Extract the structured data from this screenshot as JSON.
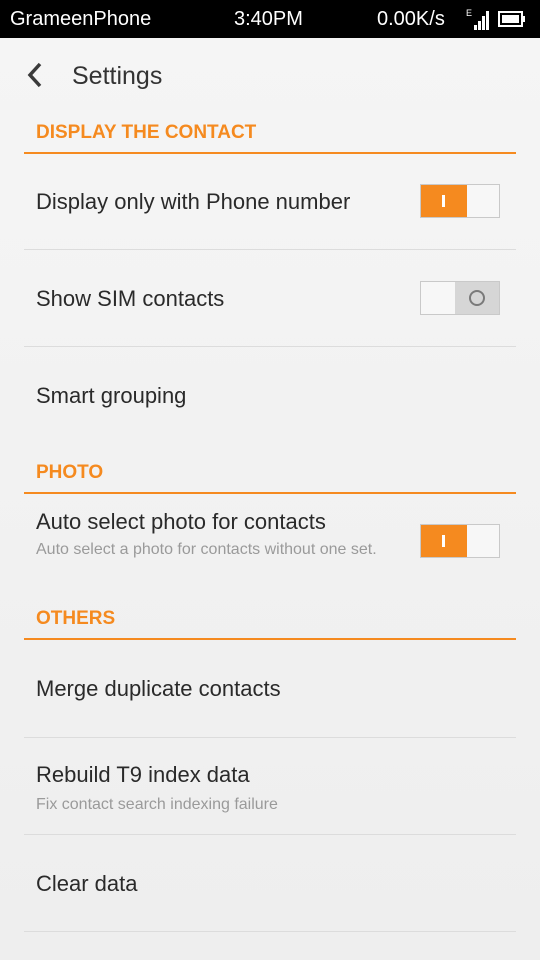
{
  "status": {
    "carrier": "GrameenPhone",
    "time": "3:40PM",
    "speed": "0.00K/s",
    "network": "E"
  },
  "header": {
    "title": "Settings"
  },
  "sections": {
    "display": "DISPLAY THE CONTACT",
    "photo": "PHOTO",
    "others": "OTHERS"
  },
  "items": {
    "display_phone": {
      "label": "Display only with Phone number",
      "enabled": true
    },
    "show_sim": {
      "label": "Show SIM contacts",
      "enabled": false
    },
    "smart_grouping": {
      "label": "Smart grouping"
    },
    "auto_photo": {
      "label": "Auto select photo for contacts",
      "sub": "Auto select a photo for contacts without one set.",
      "enabled": true
    },
    "merge": {
      "label": "Merge duplicate contacts"
    },
    "rebuild": {
      "label": "Rebuild T9 index data",
      "sub": "Fix contact search indexing failure"
    },
    "clear": {
      "label": "Clear data"
    }
  },
  "colors": {
    "accent": "#f58a1f",
    "background": "#efefef",
    "statusbar": "#000000"
  }
}
